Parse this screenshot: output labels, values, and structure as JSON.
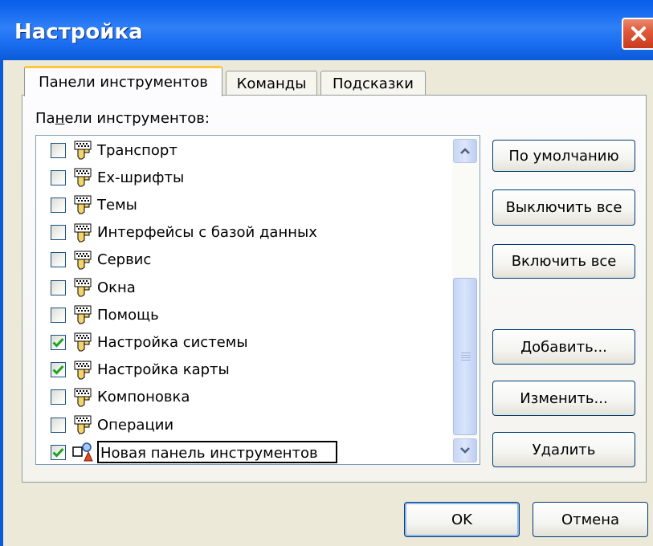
{
  "window": {
    "title": "Настройка"
  },
  "tabs": [
    {
      "label": "Панели инструментов",
      "active": true
    },
    {
      "label": "Команды",
      "active": false
    },
    {
      "label": "Подсказки",
      "active": false
    }
  ],
  "panel": {
    "label_prefix": "Па",
    "label_underline": "н",
    "label_rest": "ели инструментов:"
  },
  "toolbars": [
    {
      "label": "Транспорт",
      "checked": false,
      "icon": "toolbar-icon"
    },
    {
      "label": "Ex-шрифты",
      "checked": false,
      "icon": "toolbar-icon"
    },
    {
      "label": "Темы",
      "checked": false,
      "icon": "toolbar-icon"
    },
    {
      "label": "Интерфейсы с базой данных",
      "checked": false,
      "icon": "toolbar-icon"
    },
    {
      "label": "Сервис",
      "checked": false,
      "icon": "toolbar-icon"
    },
    {
      "label": "Окна",
      "checked": false,
      "icon": "toolbar-icon"
    },
    {
      "label": "Помощь",
      "checked": false,
      "icon": "toolbar-icon"
    },
    {
      "label": "Настройка системы",
      "checked": true,
      "icon": "toolbar-icon"
    },
    {
      "label": "Настройка карты",
      "checked": true,
      "icon": "toolbar-icon"
    },
    {
      "label": "Компоновка",
      "checked": false,
      "icon": "toolbar-icon"
    },
    {
      "label": "Операции",
      "checked": false,
      "icon": "toolbar-icon"
    },
    {
      "label": "Новая панель инструментов",
      "checked": true,
      "icon": "new-toolbar-icon",
      "editing": true
    }
  ],
  "side_buttons": {
    "defaults": "По умолчанию",
    "disable_all": "Выключить все",
    "enable_all": "Включить все",
    "add": "Добавить...",
    "edit": "Изменить...",
    "delete": "Удалить"
  },
  "footer": {
    "ok": "OK",
    "cancel": "Отмена"
  },
  "colors": {
    "titlebar": "#0b5ad9",
    "close": "#e0593c",
    "check": "#21a121",
    "tab_accent": "#ffc83c"
  }
}
